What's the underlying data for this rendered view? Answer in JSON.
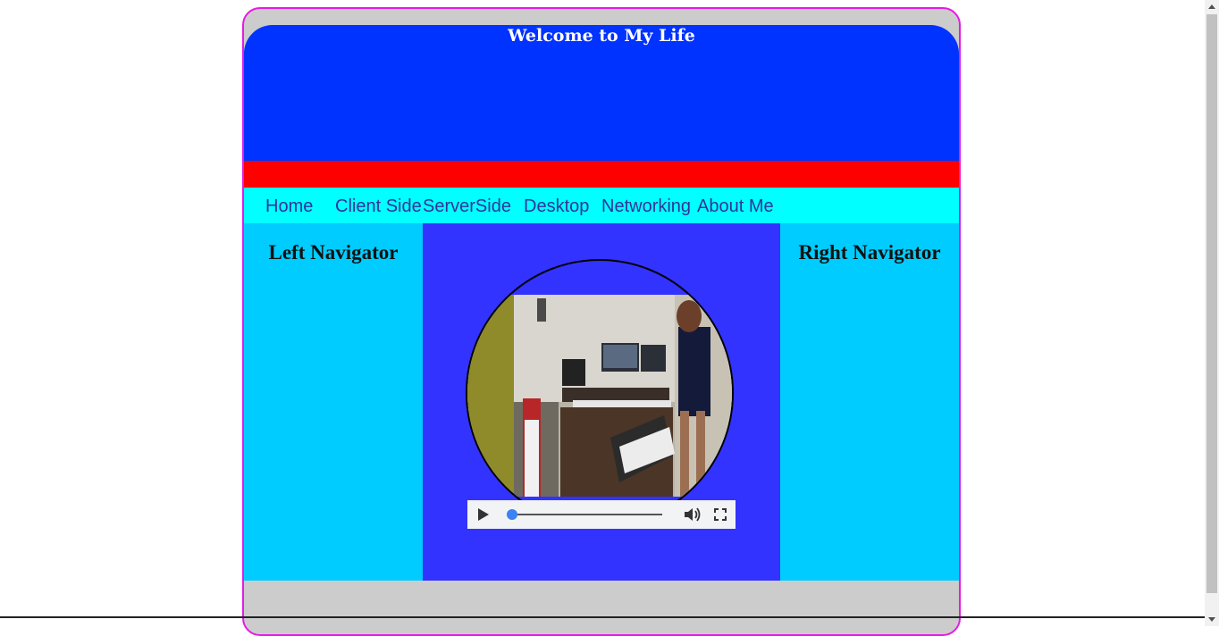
{
  "header": {
    "title": "Welcome to My Life"
  },
  "nav": {
    "items": [
      {
        "label": "Home"
      },
      {
        "label": "Client Side"
      },
      {
        "label": "ServerSide"
      },
      {
        "label": "Desktop"
      },
      {
        "label": "Networking"
      },
      {
        "label": "About Me"
      }
    ]
  },
  "left_nav": {
    "title": "Left Navigator"
  },
  "right_nav": {
    "title": "Right Navigator"
  },
  "video": {
    "controls": {
      "play_icon": "play-icon",
      "volume_icon": "volume-icon",
      "fullscreen_icon": "fullscreen-icon",
      "progress": 0
    }
  },
  "colors": {
    "border": "#e51be5",
    "header_bg": "#0033ff",
    "red_bar": "#ff0000",
    "nav_bg": "#00ffff",
    "side_bg": "#00ccff",
    "main_bg": "#3333ff",
    "page_bg": "#cccccc"
  }
}
